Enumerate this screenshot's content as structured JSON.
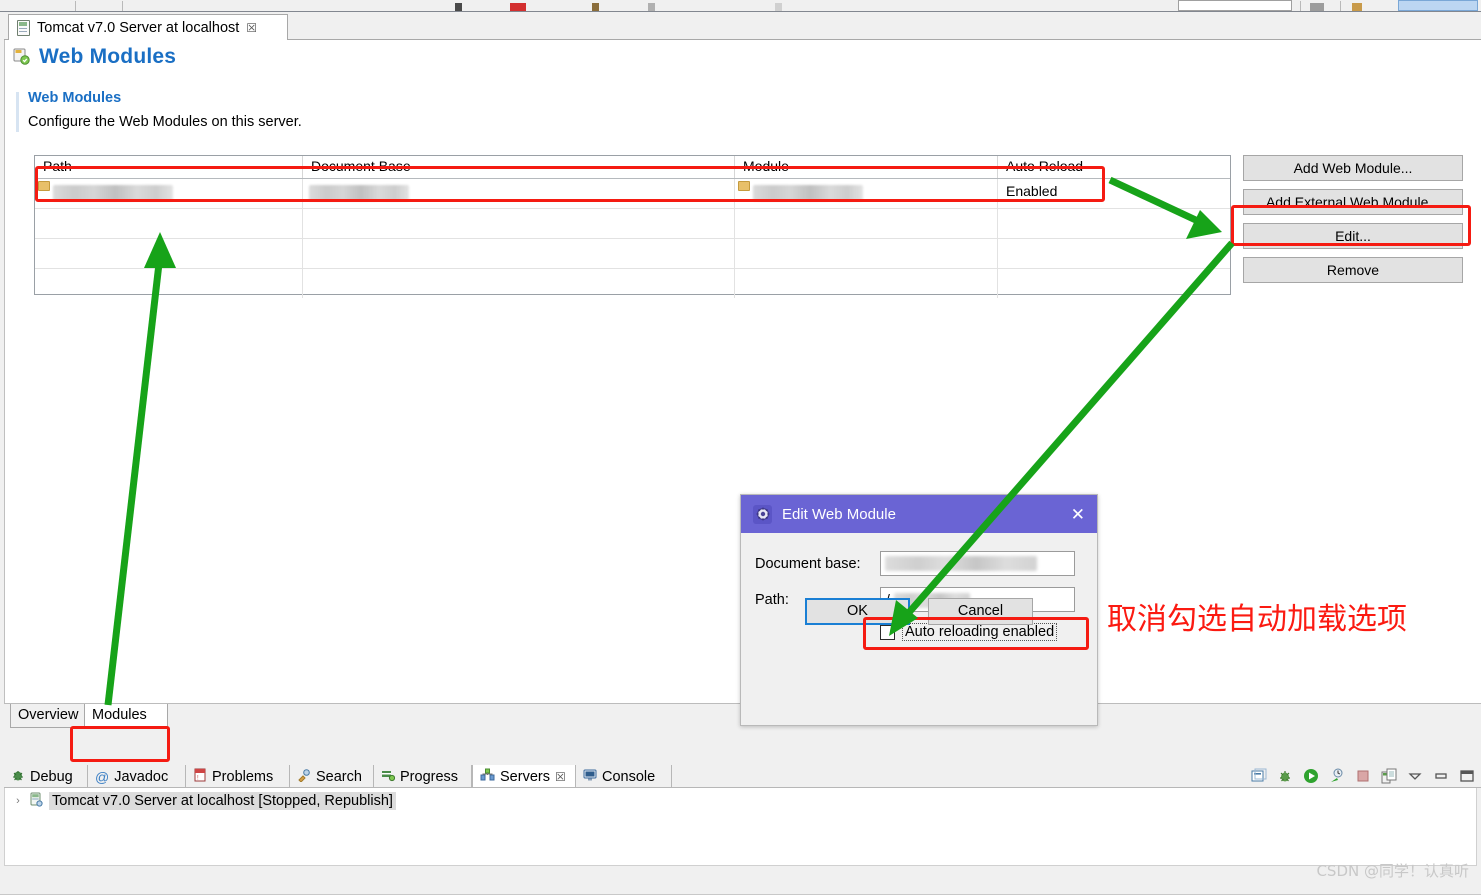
{
  "window": {
    "minimize_icon": "minimize-icon",
    "maximize_icon": "maximize-icon"
  },
  "editor": {
    "tab": {
      "icon": "server-file-icon",
      "title": "Tomcat v7.0 Server at localhost",
      "close": "☒"
    },
    "form_title": "Web Modules",
    "form_title_icon": "web-modules-icon",
    "section": {
      "header": "Web Modules",
      "description": "Configure the Web Modules on this server."
    },
    "table": {
      "columns": [
        "Path",
        "Document Base",
        "Module",
        "Auto Reload"
      ],
      "rows": [
        {
          "path": "",
          "document_base": "",
          "module": "",
          "auto_reload": "Enabled",
          "redacted": true
        },
        {
          "path": "",
          "document_base": "",
          "module": "",
          "auto_reload": "",
          "redacted": false
        },
        {
          "path": "",
          "document_base": "",
          "module": "",
          "auto_reload": "",
          "redacted": false
        },
        {
          "path": "",
          "document_base": "",
          "module": "",
          "auto_reload": "",
          "redacted": false
        }
      ]
    },
    "buttons": {
      "add_web_module": "Add Web Module...",
      "add_external_web_module": "Add External Web Module...",
      "edit": "Edit...",
      "remove": "Remove"
    },
    "bottom_tabs": [
      {
        "label": "Overview",
        "active": false
      },
      {
        "label": "Modules",
        "active": true
      }
    ]
  },
  "dialog": {
    "icon": "gear-icon",
    "title": "Edit Web Module",
    "close": "✕",
    "fields": [
      {
        "label": "Document base:",
        "value": "",
        "redacted": true
      },
      {
        "label": "Path:",
        "value": "/",
        "redacted": true
      }
    ],
    "checkbox": {
      "label": "Auto reloading enabled",
      "checked": false
    },
    "ok": "OK",
    "cancel": "Cancel"
  },
  "views": {
    "tabs": [
      {
        "label": "Debug",
        "icon": "debug-bug-icon",
        "active": false
      },
      {
        "label": "Javadoc",
        "icon": "javadoc-at-icon",
        "active": false
      },
      {
        "label": "Problems",
        "icon": "problems-icon",
        "active": false
      },
      {
        "label": "Search",
        "icon": "search-icon",
        "active": false
      },
      {
        "label": "Progress",
        "icon": "progress-icon",
        "active": false
      },
      {
        "label": "Servers",
        "icon": "servers-icon",
        "active": true,
        "close": "☒"
      },
      {
        "label": "Console",
        "icon": "console-icon",
        "active": false
      }
    ],
    "tree": {
      "expander": "›",
      "icon": "server-icon",
      "label": "Tomcat v7.0 Server at localhost  [Stopped, Republish]"
    },
    "toolbar_icons": [
      "collapse-all-icon",
      "debug-server-icon",
      "start-server-icon",
      "profile-server-icon",
      "stop-server-icon",
      "publish-icon",
      "view-menu-icon",
      "minimize-view-icon",
      "maximize-view-icon"
    ]
  },
  "annotations": {
    "chinese_note": "取消勾选自动加载选项",
    "highlight_color": "#f51b12",
    "arrow_color": "#17a319"
  },
  "watermark": "CSDN @同学！认真听"
}
